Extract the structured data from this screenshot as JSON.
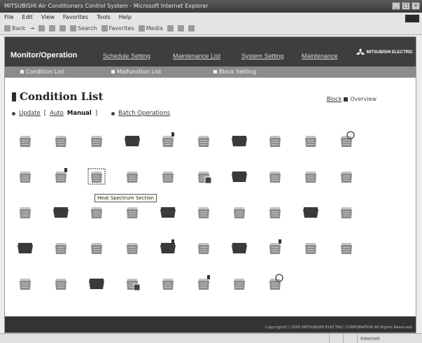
{
  "window": {
    "title": "MITSUBISHI Air Conditioners Control System - Microsoft Internet Explorer",
    "controls": [
      "_",
      "□",
      "×"
    ]
  },
  "menu": [
    "File",
    "Edit",
    "View",
    "Favorites",
    "Tools",
    "Help"
  ],
  "toolbar": [
    "Back",
    "→",
    "Search",
    "Favorites",
    "Media"
  ],
  "nav": {
    "brand": "Monitor/Operation",
    "links": [
      "Schedule Setting",
      "Maintenance List",
      "System Setting",
      "Maintenance"
    ],
    "logo": "MITSUBISHI ELECTRIC",
    "sub": [
      "Condition List",
      "Malfunction List",
      "Block Setting"
    ]
  },
  "page": {
    "title": "Condition List",
    "block_link": "Block",
    "block_label": "Overview",
    "mode": {
      "update": "Update",
      "bracket_open": "[",
      "auto": "Auto",
      "manual": "Manual",
      "bracket_close": "]",
      "batch": "Batch Operations"
    },
    "tooltip": "Heat Spectrum Section"
  },
  "units": {
    "rows": [
      [
        "on",
        "on",
        "on",
        "off",
        "alert",
        "on",
        "off",
        "on",
        "on",
        "fan"
      ],
      [
        "on",
        "alert",
        "sel",
        "on",
        "on",
        "filter",
        "off",
        "on",
        "on",
        "on"
      ],
      [
        "on",
        "off",
        "on",
        "on",
        "off",
        "on",
        "on",
        "on",
        "off",
        "on"
      ],
      [
        "off",
        "on",
        "on",
        "on",
        "offalert",
        "on",
        "off",
        "alert",
        "on",
        "on"
      ],
      [
        "on",
        "on",
        "off",
        "filter",
        "on",
        "alert",
        "on",
        "fan"
      ]
    ],
    "colors": {
      "on": "#8e8e8e",
      "off": "#3a3a3a",
      "light": "#c4c4c4"
    }
  },
  "footer": {
    "copyright": "Copyright(C) 2005 MITSUBISHI ELECTRIC CORPORATION All Rights Reserved."
  },
  "status": {
    "left": "",
    "zone": "Internet"
  }
}
